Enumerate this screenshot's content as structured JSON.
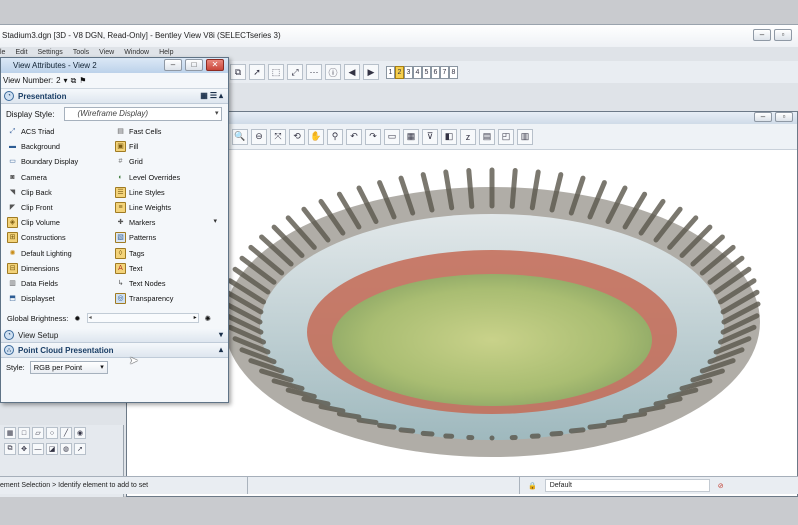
{
  "app": {
    "title": "Stadium3.dgn [3D - V8 DGN, Read-Only] - Bentley View V8i (SELECTseries 3)",
    "menu": [
      "le",
      "Edit",
      "Settings",
      "Tools",
      "View",
      "Window",
      "Help"
    ],
    "view_numbers": [
      "1",
      "2",
      "3",
      "4",
      "5",
      "6",
      "7",
      "8"
    ],
    "active_view_number": "2"
  },
  "dialog": {
    "title": "View Attributes - View 2",
    "view_number_label": "View Number:",
    "view_number_value": "2",
    "presentation": {
      "label": "Presentation",
      "display_style_label": "Display Style:",
      "display_style_value": "(Wireframe Display)",
      "attributes": [
        {
          "label": "ACS Triad",
          "icon": "acs-triad-icon"
        },
        {
          "label": "Fast Cells",
          "icon": "fast-cells-icon"
        },
        {
          "label": "Background",
          "icon": "background-icon"
        },
        {
          "label": "Fill",
          "icon": "fill-icon"
        },
        {
          "label": "Boundary Display",
          "icon": "boundary-display-icon"
        },
        {
          "label": "Grid",
          "icon": "grid-icon"
        },
        {
          "label": "Camera",
          "icon": "camera-icon"
        },
        {
          "label": "Level Overrides",
          "icon": "level-overrides-icon"
        },
        {
          "label": "Clip Back",
          "icon": "clip-back-icon"
        },
        {
          "label": "Line Styles",
          "icon": "line-styles-icon"
        },
        {
          "label": "Clip Front",
          "icon": "clip-front-icon"
        },
        {
          "label": "Line Weights",
          "icon": "line-weights-icon"
        },
        {
          "label": "Clip Volume",
          "icon": "clip-volume-icon"
        },
        {
          "label": "Markers",
          "icon": "markers-icon"
        },
        {
          "label": "Constructions",
          "icon": "constructions-icon"
        },
        {
          "label": "Patterns",
          "icon": "patterns-icon"
        },
        {
          "label": "Default Lighting",
          "icon": "default-lighting-icon"
        },
        {
          "label": "Tags",
          "icon": "tags-icon"
        },
        {
          "label": "Dimensions",
          "icon": "dimensions-icon"
        },
        {
          "label": "Text",
          "icon": "text-icon"
        },
        {
          "label": "Data Fields",
          "icon": "data-fields-icon"
        },
        {
          "label": "Text Nodes",
          "icon": "text-nodes-icon"
        },
        {
          "label": "Displayset",
          "icon": "displayset-icon"
        },
        {
          "label": "Transparency",
          "icon": "transparency-icon"
        }
      ],
      "brightness_label": "Global Brightness:"
    },
    "view_setup": {
      "label": "View Setup"
    },
    "point_cloud": {
      "label": "Point Cloud Presentation",
      "style_label": "Style:",
      "style_value": "RGB per Point"
    }
  },
  "statusbar": {
    "prompt": "ement Selection > Identify element to add to set",
    "level": "Default"
  },
  "colors": {
    "section_header_text": "#1a3e66",
    "active_view_button": "#f6cf4d",
    "field_green": "#9bb36a",
    "track_red": "#c46a55"
  }
}
